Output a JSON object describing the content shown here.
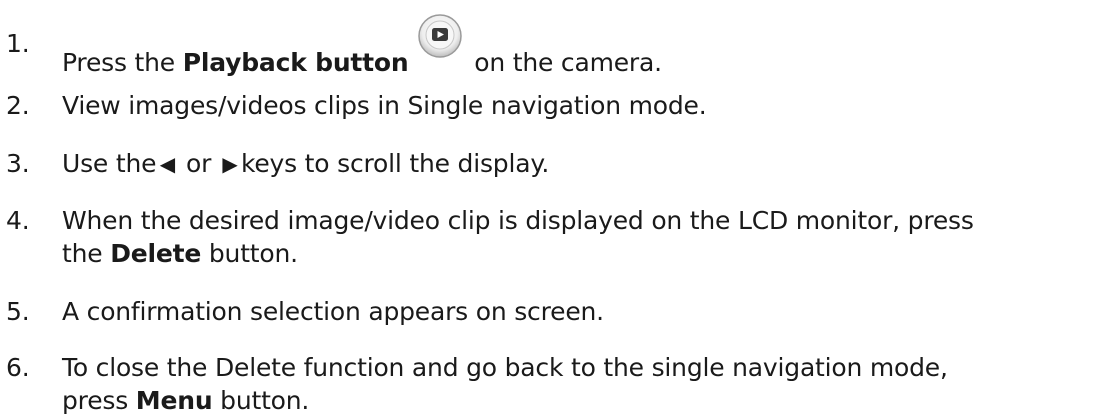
{
  "steps": [
    {
      "number": "1.",
      "prefix": "Press the ",
      "bold": "Playback button",
      "suffix": " on the camera.",
      "icon": "playback-button-icon"
    },
    {
      "number": "2.",
      "text": "View images/videos clips in Single navigation mode."
    },
    {
      "number": "3.",
      "prefix": "Use the",
      "left_key": "◀",
      "middle": " or ",
      "right_key": "▶",
      "suffix": "keys to scroll the display.",
      "icons": [
        "left-arrow-key-icon",
        "right-arrow-key-icon"
      ]
    },
    {
      "number": "4.",
      "line1": "When the desired image/video clip is displayed on the LCD monitor, press",
      "prefix": "the ",
      "bold": "Delete",
      "suffix": " button."
    },
    {
      "number": "5.",
      "text": "A confirmation selection appears on screen."
    },
    {
      "number": "6.",
      "line1": "To close the Delete function and go back to the single navigation mode,",
      "prefix": "press ",
      "bold": "Menu",
      "suffix": " button."
    }
  ]
}
